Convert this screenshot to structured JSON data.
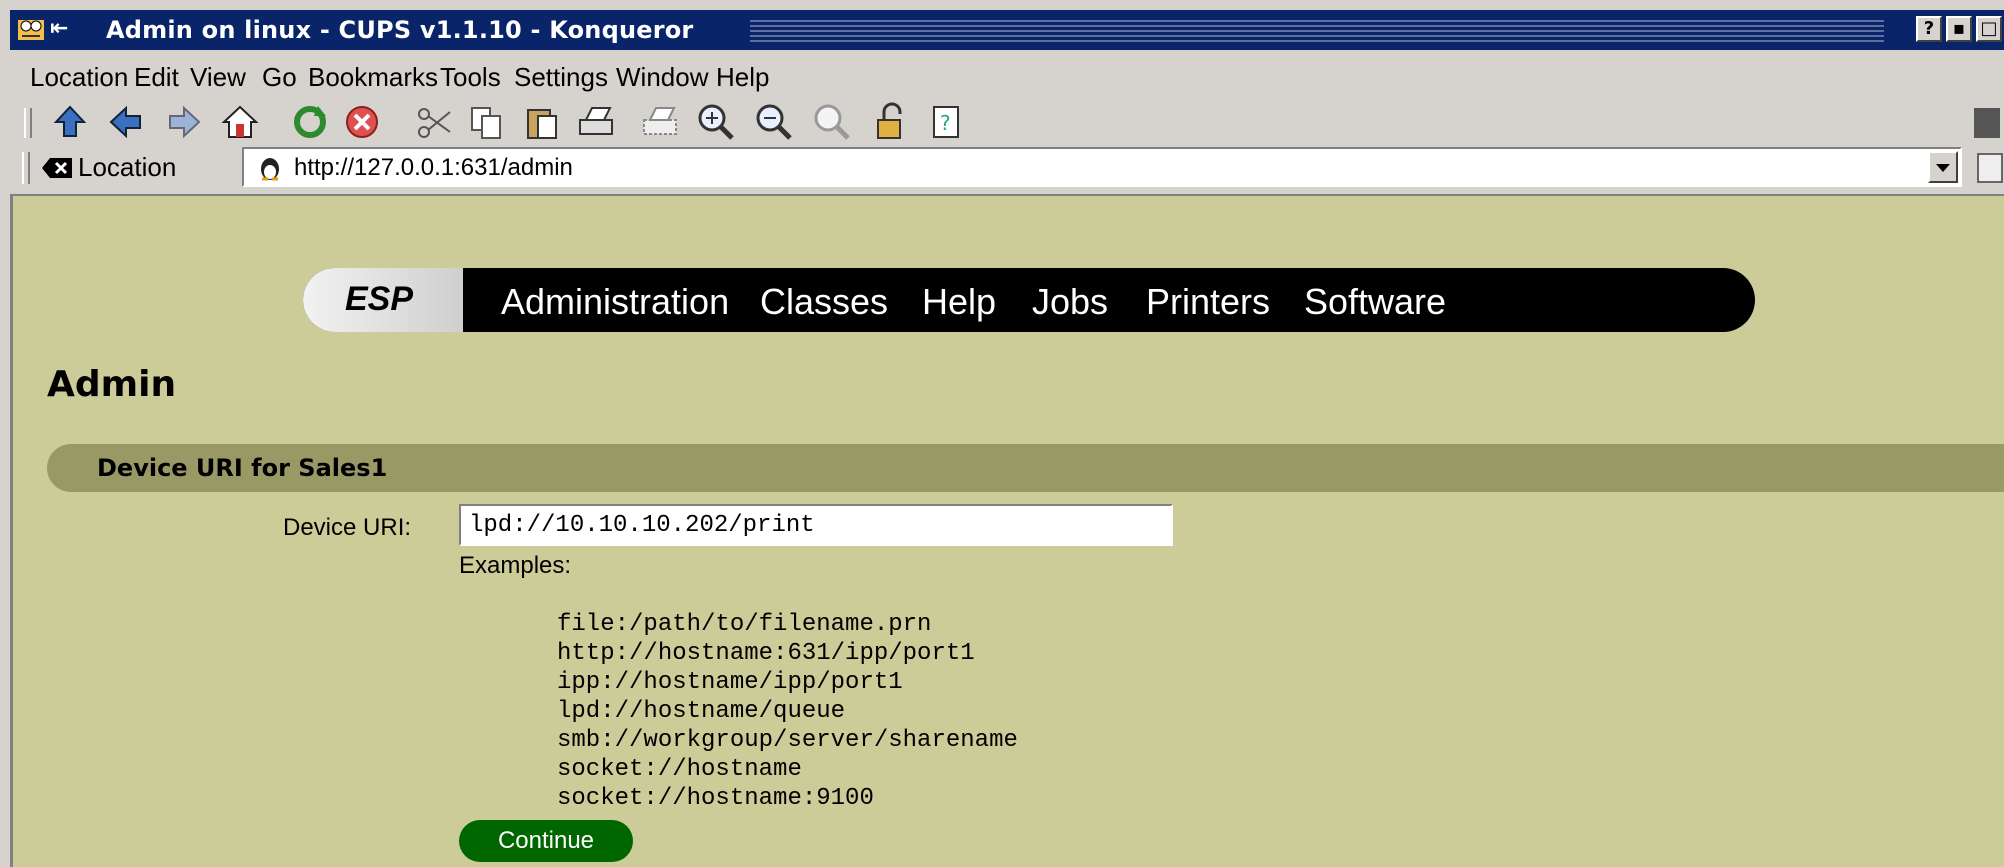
{
  "window": {
    "title": "Admin on linux - CUPS v1.1.10 - Konqueror",
    "controls": [
      "?",
      "▪",
      "□"
    ]
  },
  "menu": [
    {
      "label": "Location"
    },
    {
      "label": "Edit"
    },
    {
      "label": "View"
    },
    {
      "label": "Go"
    },
    {
      "label": "Bookmarks"
    },
    {
      "label": "Tools"
    },
    {
      "label": "Settings"
    },
    {
      "label": "Window"
    },
    {
      "label": "Help"
    }
  ],
  "toolbar": {
    "icons": [
      "up-icon",
      "back-icon",
      "forward-icon",
      "home-icon",
      "reload-icon",
      "stop-icon",
      "cut-icon",
      "copy-icon",
      "paste-icon",
      "print-icon",
      "print-frame-icon",
      "zoom-in-icon",
      "zoom-out-icon",
      "zoom-reset-icon",
      "lock-icon",
      "help-icon"
    ]
  },
  "location": {
    "label": "Location",
    "url": "http://127.0.0.1:631/admin"
  },
  "page": {
    "nav": {
      "logo": "ESP",
      "items": [
        "Administration",
        "Classes",
        "Help",
        "Jobs",
        "Printers",
        "Software"
      ]
    },
    "heading": "Admin",
    "section_title": "Device URI for Sales1",
    "field_label": "Device URI:",
    "field_value": "lpd://10.10.10.202/print",
    "examples_label": "Examples:",
    "examples": [
      "file:/path/to/filename.prn",
      "http://hostname:631/ipp/port1",
      "ipp://hostname/ipp/port1",
      "lpd://hostname/queue",
      "smb://workgroup/server/sharename",
      "socket://hostname",
      "socket://hostname:9100"
    ],
    "button": "Continue"
  },
  "colors": {
    "titlebar": "#0a246a",
    "page_bg": "#cccc99",
    "section_bg": "#999966",
    "button_bg": "#006600"
  }
}
